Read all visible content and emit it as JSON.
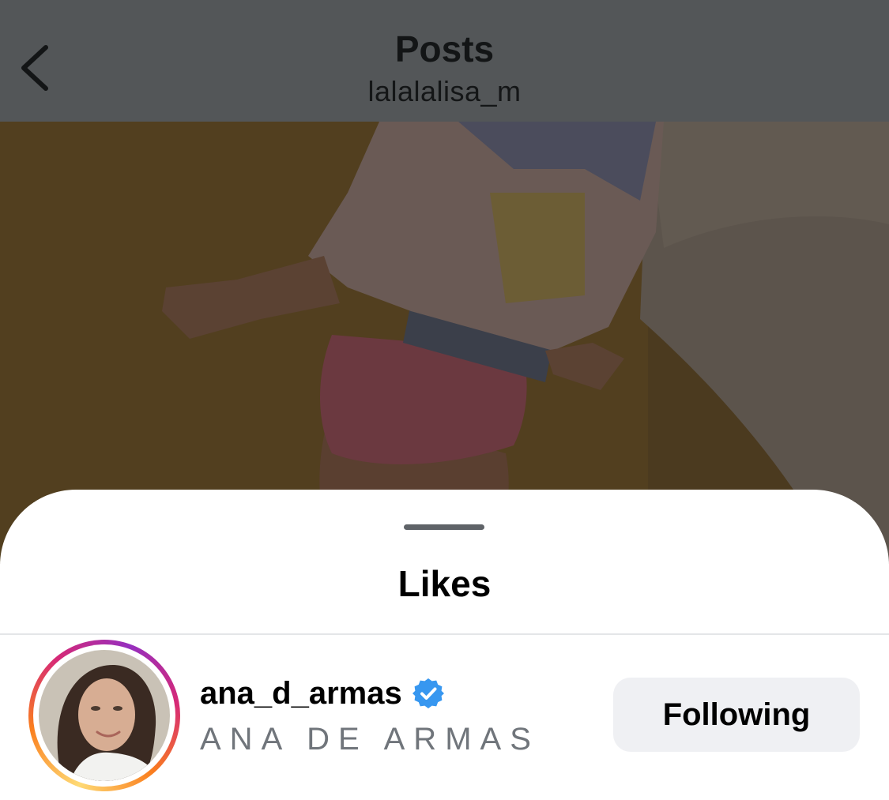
{
  "header": {
    "title": "Posts",
    "subtitle": "lalalalisa_m",
    "back_icon": "chevron-left-icon",
    "background_color": "#535658"
  },
  "post": {
    "image_description_icon": "post-photo"
  },
  "sheet": {
    "title": "Likes"
  },
  "likes": [
    {
      "username": "ana_d_armas",
      "full_name": "ANA DE ARMAS",
      "verified": true,
      "verified_icon": "verified-badge-icon",
      "has_story_ring": true,
      "follow_button_label": "Following"
    }
  ],
  "colors": {
    "verified_blue": "#3797f0",
    "button_bg": "#eff0f3",
    "secondary_text": "#70757b"
  }
}
